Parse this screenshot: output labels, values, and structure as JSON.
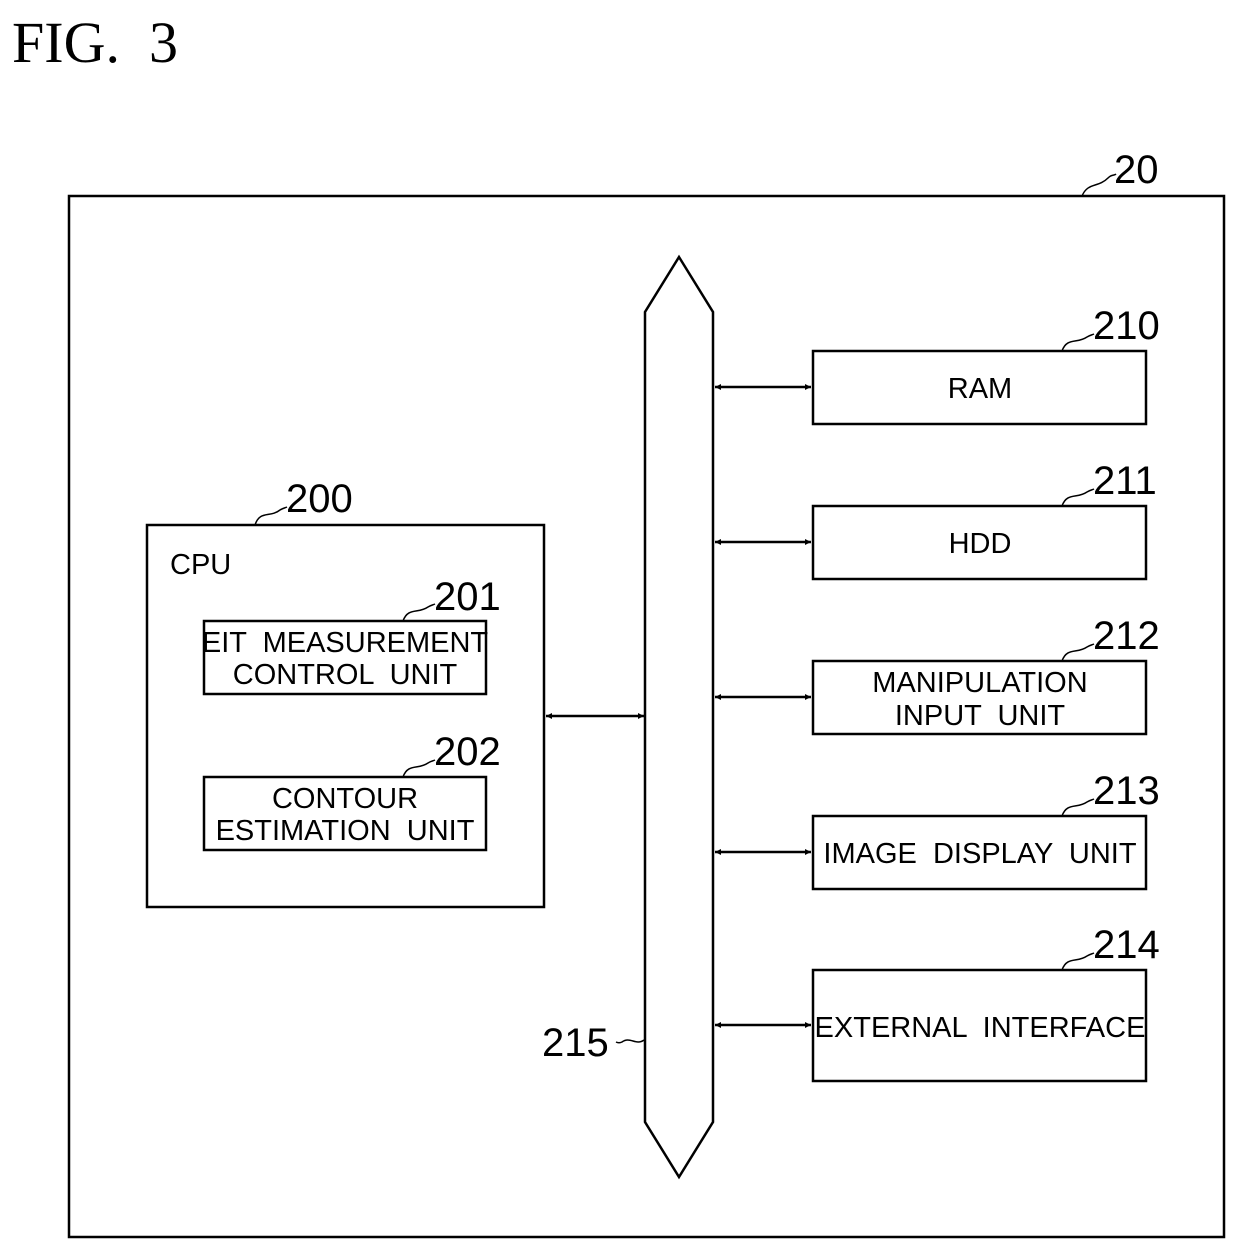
{
  "figure": {
    "title": "FIG.  3"
  },
  "device": {
    "ref": "20"
  },
  "cpu": {
    "ref": "200",
    "label": "CPU",
    "units": [
      {
        "ref": "201",
        "lines": [
          "EIT  MEASUREMENT",
          "CONTROL  UNIT"
        ]
      },
      {
        "ref": "202",
        "lines": [
          "CONTOUR",
          "ESTIMATION  UNIT"
        ]
      }
    ]
  },
  "bus": {
    "ref": "215"
  },
  "components": [
    {
      "ref": "210",
      "lines": [
        "RAM"
      ]
    },
    {
      "ref": "211",
      "lines": [
        "HDD"
      ]
    },
    {
      "ref": "212",
      "lines": [
        "MANIPULATION",
        "INPUT  UNIT"
      ]
    },
    {
      "ref": "213",
      "lines": [
        "IMAGE  DISPLAY  UNIT"
      ]
    },
    {
      "ref": "214",
      "lines": [
        "EXTERNAL  INTERFACE"
      ]
    }
  ],
  "colors": {
    "line": "#000000",
    "background": "#ffffff"
  }
}
